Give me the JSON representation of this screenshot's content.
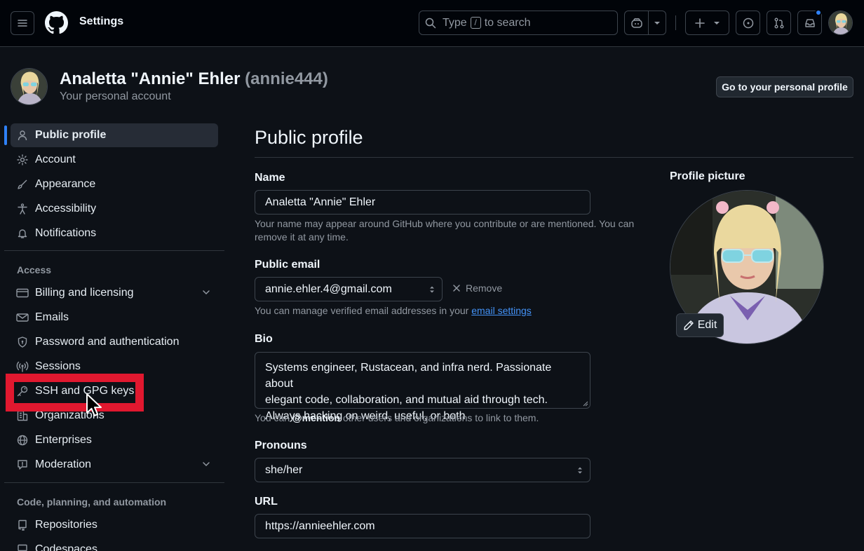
{
  "header": {
    "context_title": "Settings",
    "search": {
      "prefix": "Type",
      "key": "/",
      "suffix": "to search"
    },
    "icons": [
      "menu-icon",
      "github-logo",
      "copilot-icon",
      "plus-icon",
      "issues-icon",
      "pull-requests-icon",
      "inbox-icon"
    ],
    "notification_dot_color": "#2f81f7"
  },
  "account": {
    "display_name": "Analetta \"Annie\" Ehler",
    "handle": "(annie444)",
    "subtitle": "Your personal account",
    "profile_button": "Go to your personal profile"
  },
  "sidebar": {
    "top_items": [
      {
        "label": "Public profile",
        "icon": "person-icon",
        "active": true
      },
      {
        "label": "Account",
        "icon": "gear-icon"
      },
      {
        "label": "Appearance",
        "icon": "paintbrush-icon"
      },
      {
        "label": "Accessibility",
        "icon": "accessibility-icon"
      },
      {
        "label": "Notifications",
        "icon": "bell-icon"
      }
    ],
    "access_title": "Access",
    "access_items": [
      {
        "label": "Billing and licensing",
        "icon": "credit-card-icon",
        "expandable": true
      },
      {
        "label": "Emails",
        "icon": "mail-icon"
      },
      {
        "label": "Password and authentication",
        "icon": "shield-lock-icon"
      },
      {
        "label": "Sessions",
        "icon": "broadcast-icon"
      },
      {
        "label": "SSH and GPG keys",
        "icon": "key-icon",
        "highlighted": true
      },
      {
        "label": "Organizations",
        "icon": "organization-icon"
      },
      {
        "label": "Enterprises",
        "icon": "globe-icon"
      },
      {
        "label": "Moderation",
        "icon": "report-icon",
        "expandable": true
      }
    ],
    "code_title": "Code, planning, and automation",
    "code_items": [
      {
        "label": "Repositories",
        "icon": "repo-icon"
      },
      {
        "label": "Codespaces",
        "icon": "codespaces-icon"
      }
    ],
    "highlight_color": "#e0182f"
  },
  "main": {
    "title": "Public profile",
    "name": {
      "label": "Name",
      "value": "Analetta \"Annie\" Ehler",
      "note_line1": "Your name may appear around GitHub where you contribute or are mentioned. You can",
      "note_line2": "remove it at any time."
    },
    "email": {
      "label": "Public email",
      "value": "annie.ehler.4@gmail.com",
      "remove": "Remove",
      "note_prefix": "You can manage verified email addresses in your",
      "note_link": "email settings"
    },
    "bio": {
      "label": "Bio",
      "line1": "Systems engineer, Rustacean, and infra nerd. Passionate about",
      "line2": "elegant code, collaboration, and mutual aid through tech.",
      "line3": "Always hacking on weird, useful, or both",
      "note_prefix": "You can",
      "note_mention": "@mention",
      "note_suffix": "other users and organizations to link to them."
    },
    "pronouns": {
      "label": "Pronouns",
      "value": "she/her"
    },
    "url": {
      "label": "URL",
      "value": "https://annieehler.com"
    },
    "profile_picture": {
      "label": "Profile picture",
      "edit": "Edit"
    }
  }
}
